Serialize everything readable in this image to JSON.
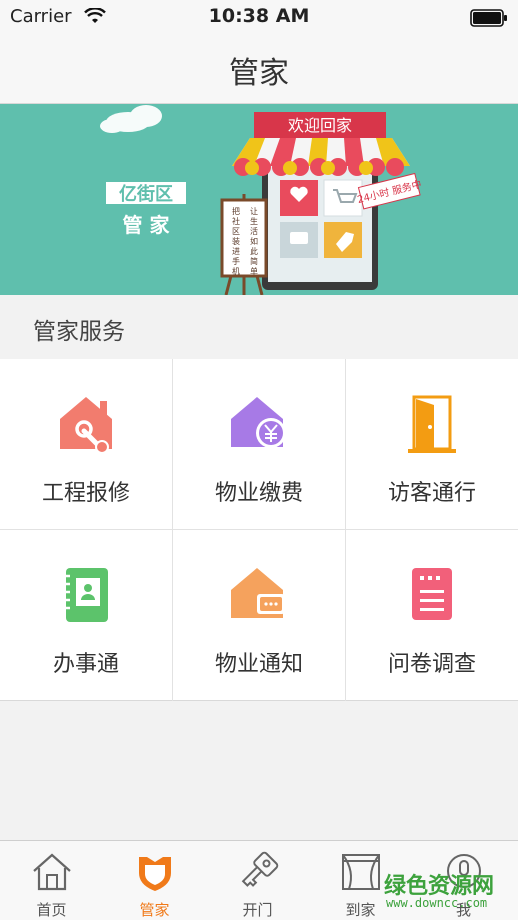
{
  "status_bar": {
    "carrier": "Carrier",
    "time": "10:38 AM"
  },
  "nav": {
    "title": "管家"
  },
  "banner": {
    "brand_line1": "亿街区",
    "brand_line2": "管 家",
    "sign_text": "欢迎回家",
    "badge_text": "24小时 服务中",
    "poster_col1": "把社区装进手机",
    "poster_col2": "让生活如此简单",
    "background_color": "#5fbfad"
  },
  "section": {
    "title": "管家服务"
  },
  "services": [
    {
      "label": "工程报修",
      "icon": "house-wrench-icon",
      "color": "#f27c6e"
    },
    {
      "label": "物业缴费",
      "icon": "house-yen-icon",
      "color": "#a77ae6"
    },
    {
      "label": "访客通行",
      "icon": "door-icon",
      "color": "#f39c12"
    },
    {
      "label": "办事通",
      "icon": "contact-book-icon",
      "color": "#5cc36b"
    },
    {
      "label": "物业通知",
      "icon": "house-message-icon",
      "color": "#f5a25d"
    },
    {
      "label": "问卷调查",
      "icon": "survey-icon",
      "color": "#f2607a"
    }
  ],
  "tabs": [
    {
      "label": "首页",
      "icon": "home-icon",
      "active": false
    },
    {
      "label": "管家",
      "icon": "shield-icon",
      "active": true
    },
    {
      "label": "开门",
      "icon": "key-icon",
      "active": false
    },
    {
      "label": "到家",
      "icon": "window-icon",
      "active": false
    },
    {
      "label": "我",
      "icon": "person-icon",
      "active": false
    }
  ],
  "watermark": {
    "text": "绿色资源网",
    "url": "www.downcc.com"
  },
  "colors": {
    "accent": "#f07a1a",
    "banner": "#5fbfad"
  }
}
